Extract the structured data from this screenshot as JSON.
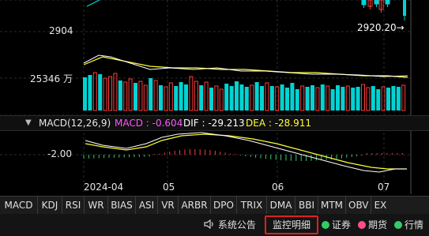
{
  "price": {
    "axis_label_2904": "2904",
    "current_price_label": "2920.20→"
  },
  "volume": {
    "axis_label": "25346 万"
  },
  "macd_panel": {
    "name": "MACD(12,26,9)",
    "macd_text": "MACD : -0.604",
    "dif_text": "DIF : -29.213",
    "dea_text": "DEA : -28.911",
    "axis_label": "-2.00"
  },
  "dates": [
    "2024-04",
    "05",
    "06",
    "07"
  ],
  "tabs": [
    "MACD",
    "KDJ",
    "RSI",
    "WR",
    "BIAS",
    "ASI",
    "VR",
    "ARBR",
    "DPO",
    "TRIX",
    "DMA",
    "BBI",
    "MTM",
    "OBV",
    "EX"
  ],
  "statusbar": {
    "announcement": "系统公告",
    "monitor_detail": "监控明细",
    "securities": "证券",
    "futures": "期货",
    "quotes": "行情"
  },
  "colors": {
    "up": "#ff3b3b",
    "down": "#00d4d4",
    "ma_white": "#ffffff",
    "ma_yellow": "#ffff33",
    "macd_pink": "#ff55ff",
    "highlight_border": "#e02020",
    "dot_green": "#33cc66",
    "dot_pink": "#ff4d88"
  },
  "icons": {
    "announcement": "speaker-icon",
    "collapse": "chevron-down-icon"
  }
}
